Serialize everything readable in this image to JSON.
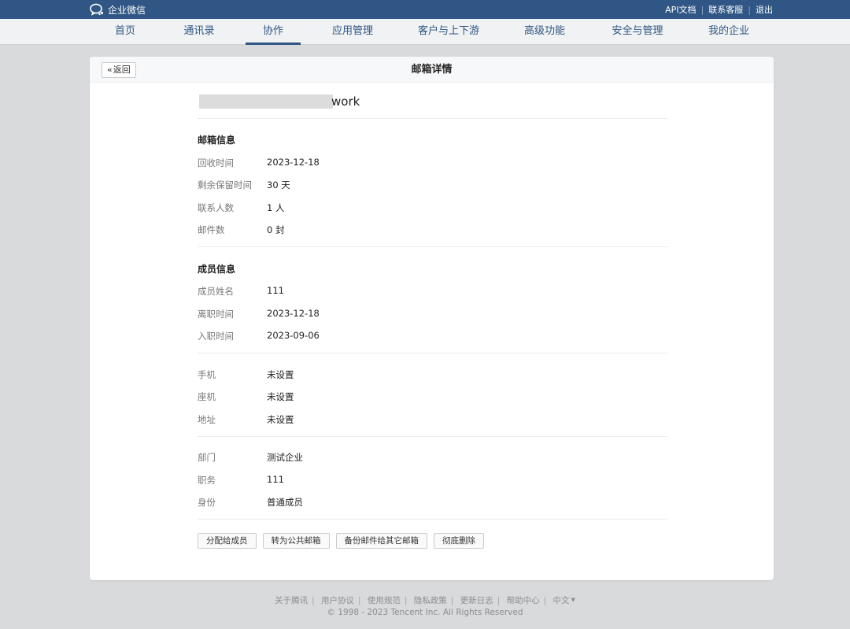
{
  "topbar": {
    "logo_text": "企业微信",
    "links": [
      "API文档",
      "联系客服",
      "退出"
    ]
  },
  "nav": {
    "items": [
      "首页",
      "通讯录",
      "协作",
      "应用管理",
      "客户与上下游",
      "高级功能",
      "安全与管理",
      "我的企业"
    ],
    "active": "协作"
  },
  "card": {
    "back_label": "返回",
    "title": "邮箱详情"
  },
  "email": {
    "visible_suffix": "work"
  },
  "mailbox_info": {
    "title": "邮箱信息",
    "rows": [
      {
        "label": "回收时间",
        "value": "2023-12-18"
      },
      {
        "label": "剩余保留时间",
        "value": "30 天"
      },
      {
        "label": "联系人数",
        "value": "1 人"
      },
      {
        "label": "邮件数",
        "value": "0 封"
      }
    ]
  },
  "member_info": {
    "title": "成员信息",
    "rows": [
      {
        "label": "成员姓名",
        "value": "111"
      },
      {
        "label": "离职时间",
        "value": "2023-12-18"
      },
      {
        "label": "入职时间",
        "value": "2023-09-06"
      }
    ]
  },
  "contact_info": {
    "rows": [
      {
        "label": "手机",
        "value": "未设置"
      },
      {
        "label": "座机",
        "value": "未设置"
      },
      {
        "label": "地址",
        "value": "未设置"
      }
    ]
  },
  "org_info": {
    "rows": [
      {
        "label": "部门",
        "value": "测试企业"
      },
      {
        "label": "职务",
        "value": "111"
      },
      {
        "label": "身份",
        "value": "普通成员"
      }
    ]
  },
  "actions": [
    "分配给成员",
    "转为公共邮箱",
    "备份邮件给其它邮箱",
    "彻底删除"
  ],
  "footer": {
    "links": [
      "关于腾讯",
      "用户协议",
      "使用规范",
      "隐私政策",
      "更新日志",
      "帮助中心"
    ],
    "language": "中文",
    "copyright": "© 1998 - 2023 Tencent Inc. All Rights Reserved"
  },
  "colors": {
    "topbar": "#2f5684",
    "nav_active": "#2f5684",
    "page_bg": "#d9dadb"
  }
}
